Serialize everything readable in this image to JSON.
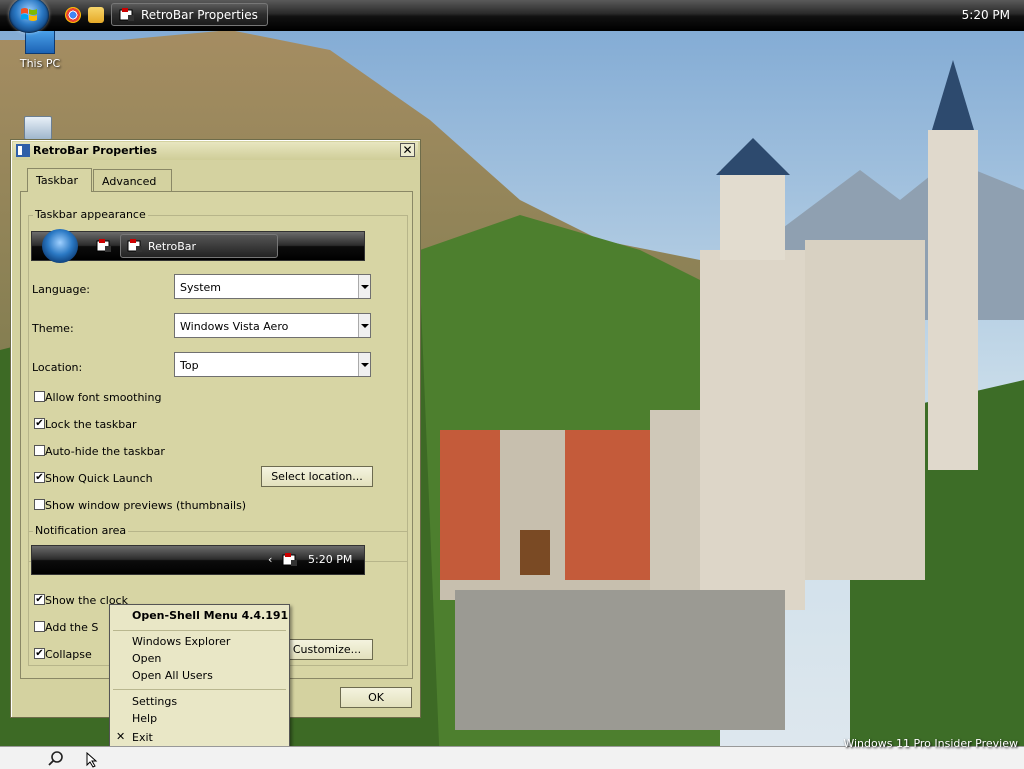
{
  "taskbar": {
    "start_label": "Start",
    "task_button_label": "RetroBar Properties",
    "clock": "5:20 PM"
  },
  "desktop": {
    "icons": [
      {
        "label": "This PC"
      },
      {
        "label": "Recycle Bin"
      }
    ],
    "watermark": "Windows 11 Pro Insider Preview"
  },
  "dialog": {
    "title": "RetroBar Properties",
    "tabs": [
      {
        "label": "Taskbar"
      },
      {
        "label": "Advanced"
      }
    ],
    "appearance": {
      "group_title": "Taskbar appearance",
      "preview_task_label": "RetroBar",
      "language_label": "Language:",
      "language_value": "System",
      "theme_label": "Theme:",
      "theme_value": "Windows Vista Aero",
      "location_label": "Location:",
      "location_value": "Top",
      "checkboxes": [
        {
          "label": "Allow font smoothing",
          "checked": false
        },
        {
          "label": "Lock the taskbar",
          "checked": true
        },
        {
          "label": "Auto-hide the taskbar",
          "checked": false
        },
        {
          "label": "Show Quick Launch",
          "checked": true
        },
        {
          "label": "Show window previews (thumbnails)",
          "checked": false
        }
      ],
      "select_location_button": "Select location..."
    },
    "notification": {
      "group_title": "Notification area",
      "preview_clock": "5:20 PM",
      "checkboxes": [
        {
          "label": "Show the clock",
          "checked": true
        },
        {
          "label": "Add the S",
          "checked": false
        },
        {
          "label": "Collapse",
          "checked": true
        }
      ],
      "customize_button": "Customize..."
    },
    "ok_button": "OK"
  },
  "context_menu": {
    "header": "Open-Shell Menu 4.4.191",
    "items_group1": [
      "Windows Explorer",
      "Open",
      "Open All Users"
    ],
    "items_group2": [
      "Settings",
      "Help"
    ],
    "exit_label": "Exit"
  }
}
